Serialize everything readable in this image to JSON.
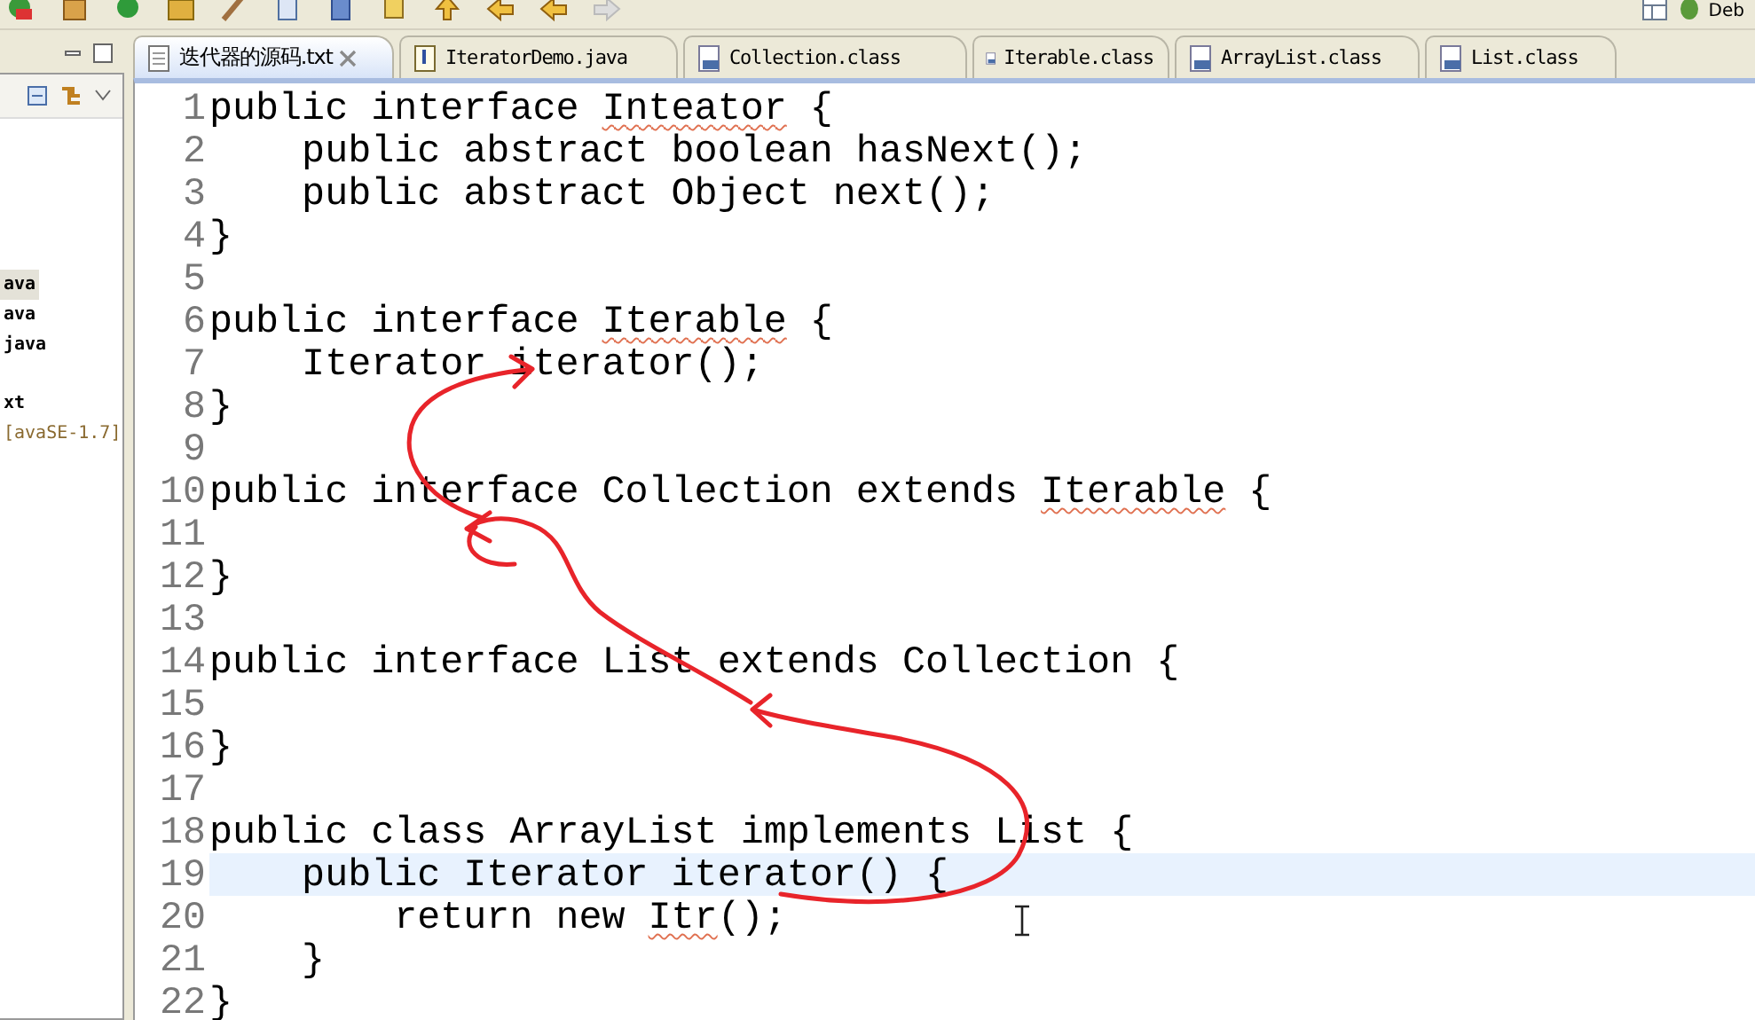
{
  "toolbar": {
    "perspective": "Deb"
  },
  "tabs": [
    {
      "label": "迭代器的源码.txt",
      "kind": "text",
      "selected": true
    },
    {
      "label": "IteratorDemo.java",
      "kind": "java",
      "selected": false
    },
    {
      "label": "Collection.class",
      "kind": "class",
      "selected": false
    },
    {
      "label": "Iterable.class",
      "kind": "class",
      "selected": false
    },
    {
      "label": "ArrayList.class",
      "kind": "class",
      "selected": false
    },
    {
      "label": "List.class",
      "kind": "class",
      "selected": false
    }
  ],
  "explorer": {
    "items": [
      {
        "label": "ava",
        "kind": "file",
        "selected": true
      },
      {
        "label": "ava",
        "kind": "file",
        "selected": false
      },
      {
        "label": "java",
        "kind": "file",
        "selected": false
      },
      {
        "label": "xt",
        "kind": "file",
        "selected": false
      },
      {
        "label": "[avaSE-1.7]",
        "kind": "library",
        "selected": false
      }
    ]
  },
  "editor": {
    "lines": [
      {
        "number": "1",
        "current": false,
        "segments": [
          {
            "text": "public interface "
          },
          {
            "text": "Inteator",
            "flagged": true
          },
          {
            "text": " {"
          }
        ]
      },
      {
        "number": "2",
        "current": false,
        "segments": [
          {
            "text": "    public abstract boolean hasNext();"
          }
        ]
      },
      {
        "number": "3",
        "current": false,
        "segments": [
          {
            "text": "    public abstract Object next();"
          }
        ]
      },
      {
        "number": "4",
        "current": false,
        "segments": [
          {
            "text": "}"
          }
        ]
      },
      {
        "number": "5",
        "current": false
      },
      {
        "number": "6",
        "current": false,
        "segments": [
          {
            "text": "public interface "
          },
          {
            "text": "Iterable",
            "flagged": true
          },
          {
            "text": " {"
          }
        ]
      },
      {
        "number": "7",
        "current": false,
        "segments": [
          {
            "text": "    Iterator iterator();"
          }
        ]
      },
      {
        "number": "8",
        "current": false,
        "segments": [
          {
            "text": "}"
          }
        ]
      },
      {
        "number": "9",
        "current": false
      },
      {
        "number": "10",
        "current": false,
        "segments": [
          {
            "text": "public interface Collection extends "
          },
          {
            "text": "Iterable",
            "flagged": true
          },
          {
            "text": " {"
          }
        ]
      },
      {
        "number": "11",
        "current": false
      },
      {
        "number": "12",
        "current": false,
        "segments": [
          {
            "text": "}"
          }
        ]
      },
      {
        "number": "13",
        "current": false
      },
      {
        "number": "14",
        "current": false,
        "segments": [
          {
            "text": "public interface List extends Collection {"
          }
        ]
      },
      {
        "number": "15",
        "current": false
      },
      {
        "number": "16",
        "current": false,
        "segments": [
          {
            "text": "}"
          }
        ]
      },
      {
        "number": "17",
        "current": false
      },
      {
        "number": "18",
        "current": false,
        "segments": [
          {
            "text": "public class ArrayList implements List {"
          }
        ]
      },
      {
        "number": "19",
        "current": true,
        "segments": [
          {
            "text": "    public Iterator iterator() {"
          }
        ]
      },
      {
        "number": "20",
        "current": false,
        "segments": [
          {
            "text": "        return new "
          },
          {
            "text": "Itr",
            "flagged": true
          },
          {
            "text": "();"
          }
        ]
      },
      {
        "number": "21",
        "current": false,
        "segments": [
          {
            "text": "    }"
          }
        ]
      },
      {
        "number": "22",
        "current": false,
        "segments": [
          {
            "text": "}"
          }
        ]
      }
    ]
  }
}
